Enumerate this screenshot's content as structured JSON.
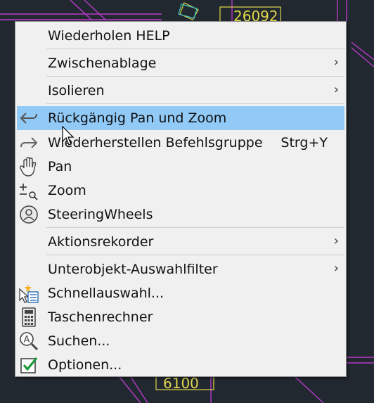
{
  "background": {
    "drawing_labels": [
      "26092",
      "6100"
    ],
    "canvas_color": "#212830",
    "line_color": "#b83ac9",
    "accent_color": "#e2d84a"
  },
  "menu": {
    "highlight_color": "#91c9f7",
    "items": [
      {
        "label": "Wiederholen HELP",
        "submenu": false,
        "shortcut": "",
        "icon": ""
      },
      {
        "label": "Zwischenablage",
        "submenu": true,
        "shortcut": "",
        "icon": ""
      },
      {
        "label": "Isolieren",
        "submenu": true,
        "shortcut": "",
        "icon": ""
      },
      {
        "label": "Rückgängig Pan und Zoom",
        "submenu": false,
        "shortcut": "",
        "icon": "undo-arrow-icon",
        "highlighted": true
      },
      {
        "label": "Wiederherstellen Befehlsgruppe",
        "submenu": false,
        "shortcut": "Strg+Y",
        "icon": "redo-arrow-icon"
      },
      {
        "label": "Pan",
        "submenu": false,
        "shortcut": "",
        "icon": "pan-hand-icon"
      },
      {
        "label": "Zoom",
        "submenu": false,
        "shortcut": "",
        "icon": "zoom-icon"
      },
      {
        "label": "SteeringWheels",
        "submenu": false,
        "shortcut": "",
        "icon": "steering-wheels-icon"
      },
      {
        "label": "Aktionsrekorder",
        "submenu": true,
        "shortcut": "",
        "icon": ""
      },
      {
        "label": "Unterobjekt-Auswahlfilter",
        "submenu": true,
        "shortcut": "",
        "icon": ""
      },
      {
        "label": "Schnellauswahl...",
        "submenu": false,
        "shortcut": "",
        "icon": "quick-select-icon"
      },
      {
        "label": "Taschenrechner",
        "submenu": false,
        "shortcut": "",
        "icon": "calculator-icon"
      },
      {
        "label": "Suchen...",
        "submenu": false,
        "shortcut": "",
        "icon": "find-icon"
      },
      {
        "label": "Optionen...",
        "submenu": false,
        "shortcut": "",
        "icon": "options-checkbox-icon"
      }
    ],
    "submenu_arrow": "›"
  }
}
